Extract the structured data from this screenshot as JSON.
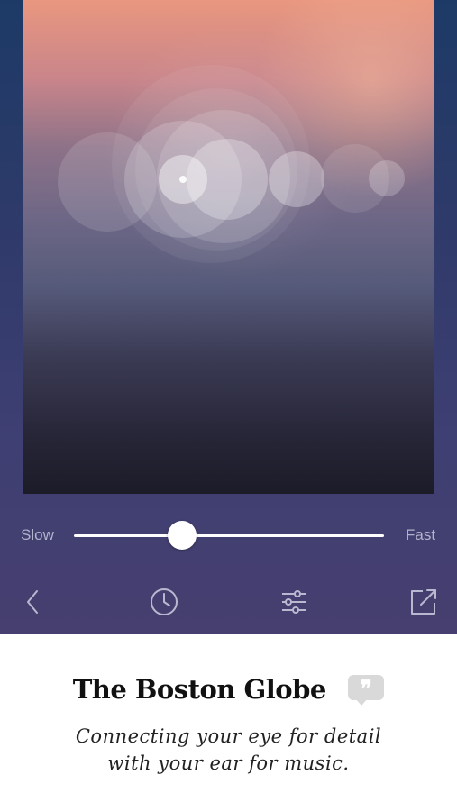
{
  "speed_control": {
    "min_label": "Slow",
    "max_label": "Fast",
    "value": 0.35
  },
  "toolbar": {
    "items": [
      {
        "name": "back",
        "icon": "chevron-left-icon"
      },
      {
        "name": "history",
        "icon": "clock-icon"
      },
      {
        "name": "settings",
        "icon": "sliders-icon"
      },
      {
        "name": "share",
        "icon": "share-icon"
      }
    ]
  },
  "promo": {
    "brand": "The Boston Globe",
    "quote_icon": "quote-bubble-icon",
    "tagline_line1": "Connecting your eye for detail",
    "tagline_line2": "with your ear for music."
  },
  "colors": {
    "app_background_top": "#1d3a66",
    "app_background_bottom": "#463f6f",
    "accent": "#ffffff",
    "label_muted": "#b3b3cc",
    "promo_background": "#ffffff"
  }
}
